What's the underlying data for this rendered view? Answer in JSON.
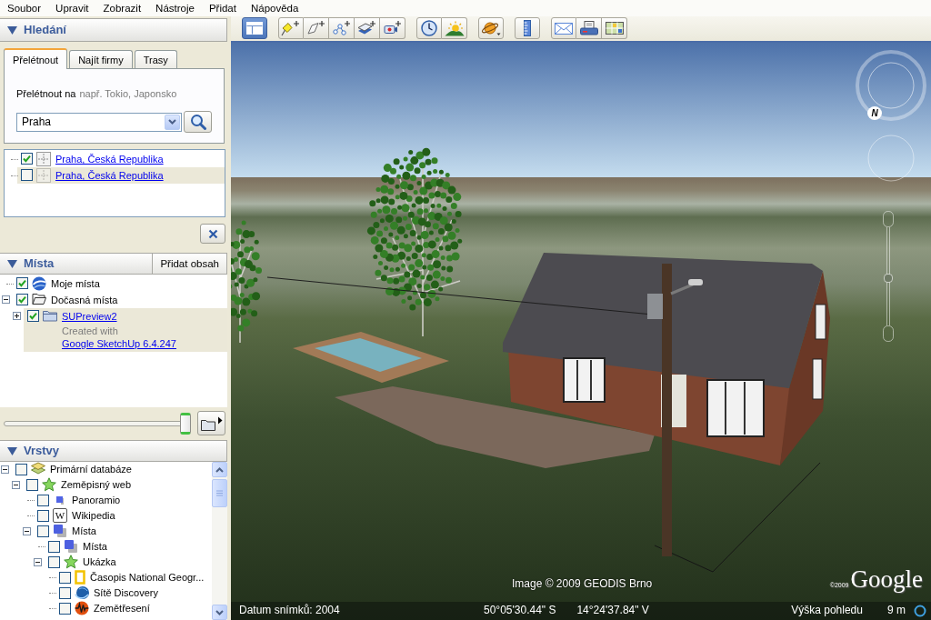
{
  "menu": [
    "Soubor",
    "Upravit",
    "Zobrazit",
    "Nástroje",
    "Přidat",
    "Nápověda"
  ],
  "search_panel": {
    "title": "Hledání",
    "expanded": true,
    "tabs": [
      {
        "label": "Přelétnout",
        "selected": true
      },
      {
        "label": "Najít firmy",
        "selected": false
      },
      {
        "label": "Trasy",
        "selected": false
      }
    ],
    "prompt": "Přelétnout na",
    "hint": "např. Tokio, Japonsko",
    "query": "Praha",
    "results": [
      {
        "label": "Praha, Česká Republika",
        "checked": true,
        "selected": false
      },
      {
        "label": "Praha, Česká Republika",
        "checked": false,
        "selected": true
      }
    ]
  },
  "places_panel": {
    "title": "Místa",
    "expanded": true,
    "add_button": "Přidat obsah",
    "items": [
      {
        "label": "Moje místa",
        "kind": "globe",
        "link": false,
        "checked": true,
        "selected": false
      },
      {
        "label": "Dočasná místa",
        "kind": "folder-open",
        "link": false,
        "checked": true,
        "selected": false,
        "expanded": true,
        "children": [
          {
            "label": "SUPreview2",
            "kind": "folder",
            "link": true,
            "checked": true,
            "selected": true,
            "expanded": false,
            "description": "Created with",
            "description_link": "Google SketchUp 6.4.247"
          }
        ]
      }
    ],
    "opacity_slider": {
      "level": 1
    }
  },
  "layers_panel": {
    "title": "Vrstvy",
    "expanded": true,
    "items": [
      {
        "label": "Primární databáze",
        "kind": "layers",
        "checked": false,
        "expanded": true,
        "children": [
          {
            "label": "Zeměpisný web",
            "kind": "star",
            "checked": false,
            "expanded": true,
            "children": [
              {
                "label": "Panoramio",
                "kind": "square",
                "checked": false
              },
              {
                "label": "Wikipedia",
                "kind": "letter",
                "icon_letter": "W",
                "checked": false
              },
              {
                "label": "Místa",
                "kind": "squares",
                "checked": false,
                "expanded": true,
                "children": [
                  {
                    "label": "Místa",
                    "kind": "squares",
                    "checked": false
                  },
                  {
                    "label": "Ukázka",
                    "kind": "star",
                    "checked": false,
                    "expanded": true,
                    "children": [
                      {
                        "label": "Časopis National Geogr...",
                        "kind": "frame",
                        "checked": false
                      },
                      {
                        "label": "Sítě Discovery",
                        "kind": "swirl-globe",
                        "checked": false
                      },
                      {
                        "label": "Zemětřesení",
                        "kind": "quake",
                        "checked": false
                      }
                    ]
                  }
                ]
              }
            ]
          }
        ]
      }
    ]
  },
  "toolbar": {
    "groups": [
      [
        {
          "kind": "sidebar",
          "on": true
        }
      ],
      [
        {
          "kind": "placemark",
          "on": false
        },
        {
          "kind": "polygon",
          "on": false
        },
        {
          "kind": "path",
          "on": false
        },
        {
          "kind": "overlay",
          "on": false
        },
        {
          "kind": "tour",
          "on": false
        }
      ],
      [
        {
          "kind": "history",
          "on": false
        },
        {
          "kind": "sunlight",
          "on": false
        }
      ],
      [
        {
          "kind": "planets",
          "on": false
        }
      ],
      [
        {
          "kind": "ruler",
          "on": false
        }
      ],
      [
        {
          "kind": "email",
          "on": false
        },
        {
          "kind": "print",
          "on": false
        },
        {
          "kind": "maps",
          "on": false
        }
      ]
    ]
  },
  "map": {
    "compass_label": "N",
    "zoom_slider": {
      "level": 0.48
    },
    "attribution": "Image © 2009 GEODIS Brno",
    "logo_year": "©2009",
    "logo": "Google",
    "status_bar": {
      "imagery_date": "Datum snímků: 2004",
      "latitude": "50°05'30.44\" S",
      "longitude": "14°24'37.84\" V",
      "altitude_label": "Výška pohledu",
      "altitude": "9 m"
    }
  }
}
